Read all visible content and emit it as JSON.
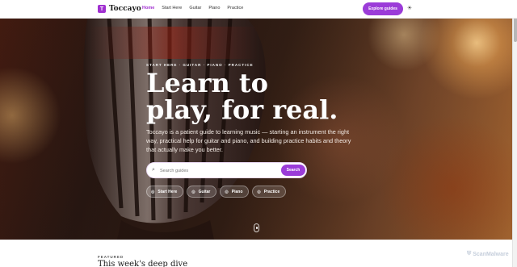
{
  "header": {
    "brand": {
      "logo_letter": "T",
      "name": "Toccayo"
    },
    "nav": [
      {
        "label": "Home",
        "active": true
      },
      {
        "label": "Start Here",
        "active": false
      },
      {
        "label": "Guitar",
        "active": false
      },
      {
        "label": "Piano",
        "active": false
      },
      {
        "label": "Practice",
        "active": false
      }
    ],
    "cta_label": "Explore guides",
    "theme_icon": "sun-icon"
  },
  "hero": {
    "eyebrow": "START HERE · GUITAR · PIANO · PRACTICE",
    "headline_line1": "Learn to",
    "headline_line2": "play, for real.",
    "lede": "Toccayo is a patient guide to learning music — starting an instrument the right way, practical help for guitar and piano, and building practice habits and theory that actually make you better.",
    "search": {
      "placeholder": "Search guides",
      "button_label": "Search"
    },
    "chips": [
      {
        "label": "Start Here",
        "icon": "compass-icon"
      },
      {
        "label": "Guitar",
        "icon": "guitar-icon"
      },
      {
        "label": "Piano",
        "icon": "piano-icon"
      },
      {
        "label": "Practice",
        "icon": "practice-icon"
      }
    ]
  },
  "featured": {
    "label": "FEATURED",
    "title": "This week's deep dive"
  },
  "watermark": "ScanMalware",
  "colors": {
    "accent": "#9b3cd8",
    "brand": "#a02fd0"
  }
}
